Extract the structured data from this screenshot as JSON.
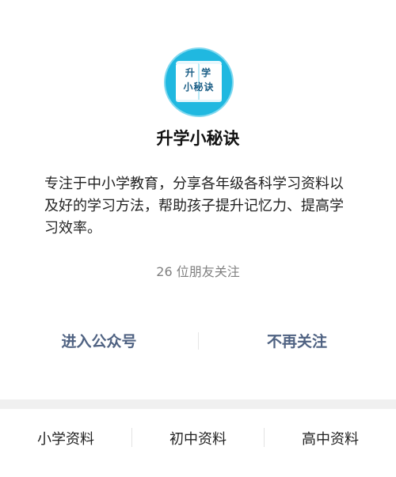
{
  "account": {
    "name": "升学小秘诀",
    "logo_text_line1": "升 学",
    "logo_text_line2": "小秘诀",
    "description": "专注于中小学教育，分享各年级各科学习资料以及好的学习方法，帮助孩子提升记忆力、提高学习效率。",
    "followers": "26 位朋友关注"
  },
  "actions": {
    "enter_label": "进入公众号",
    "unfollow_label": "不再关注"
  },
  "menu": {
    "items": [
      {
        "label": "小学资料"
      },
      {
        "label": "初中资料"
      },
      {
        "label": "高中资料"
      }
    ]
  },
  "colors": {
    "accent_link": "#4f6282",
    "logo_bg": "#20b8e0"
  }
}
